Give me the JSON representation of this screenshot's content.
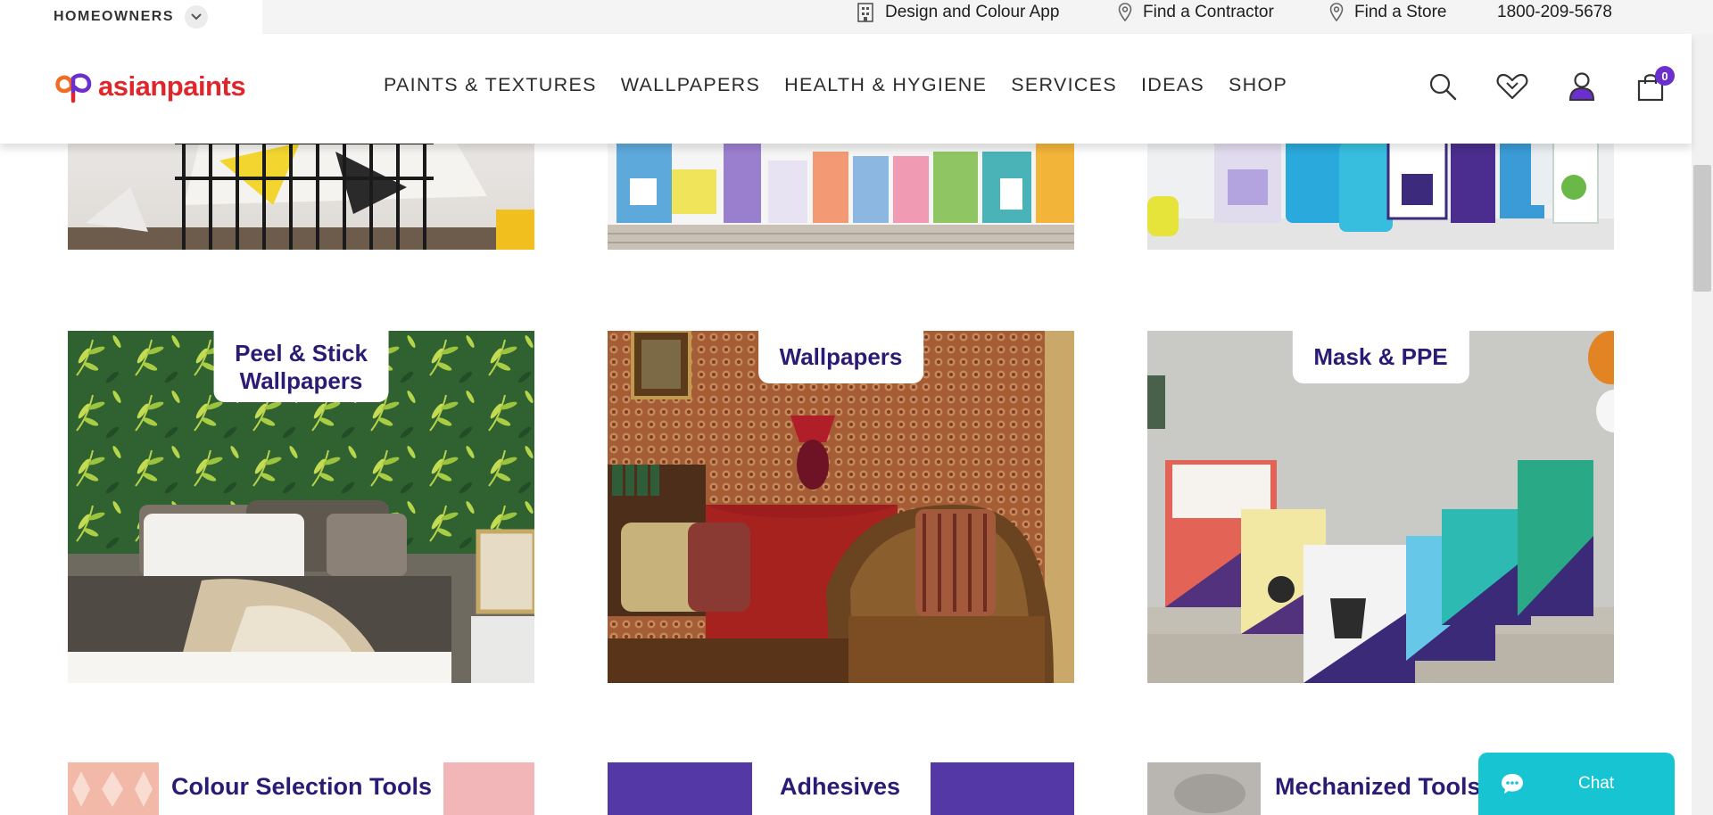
{
  "topbar": {
    "segment": "HOMEOWNERS",
    "links": [
      {
        "label": "Design and Colour App",
        "icon": "building-icon"
      },
      {
        "label": "Find a Contractor",
        "icon": "location-pin-icon"
      },
      {
        "label": "Find a Store",
        "icon": "location-pin-icon"
      }
    ],
    "phone": "1800-209-5678"
  },
  "header": {
    "brand": "asianpaints",
    "nav": [
      "PAINTS & TEXTURES",
      "WALLPAPERS",
      "HEALTH & HYGIENE",
      "SERVICES",
      "IDEAS",
      "SHOP"
    ],
    "cart_count": "0",
    "icons": [
      "search-icon",
      "heart-icon",
      "user-icon",
      "cart-icon"
    ]
  },
  "grid": {
    "row2": [
      {
        "title_line1": "Peel & Stick",
        "title_line2": "Wallpapers"
      },
      {
        "title_line1": "Wallpapers",
        "title_line2": ""
      },
      {
        "title_line1": "Mask & PPE",
        "title_line2": ""
      }
    ],
    "row3": [
      "Colour Selection Tools",
      "Adhesives",
      "Mechanized Tools"
    ]
  },
  "chat": {
    "label": "Chat"
  },
  "colors": {
    "brand_red": "#e0262a",
    "title_purple": "#2c1b75",
    "chat_teal": "#17c5d2",
    "badge_purple": "#6a2fcc"
  }
}
